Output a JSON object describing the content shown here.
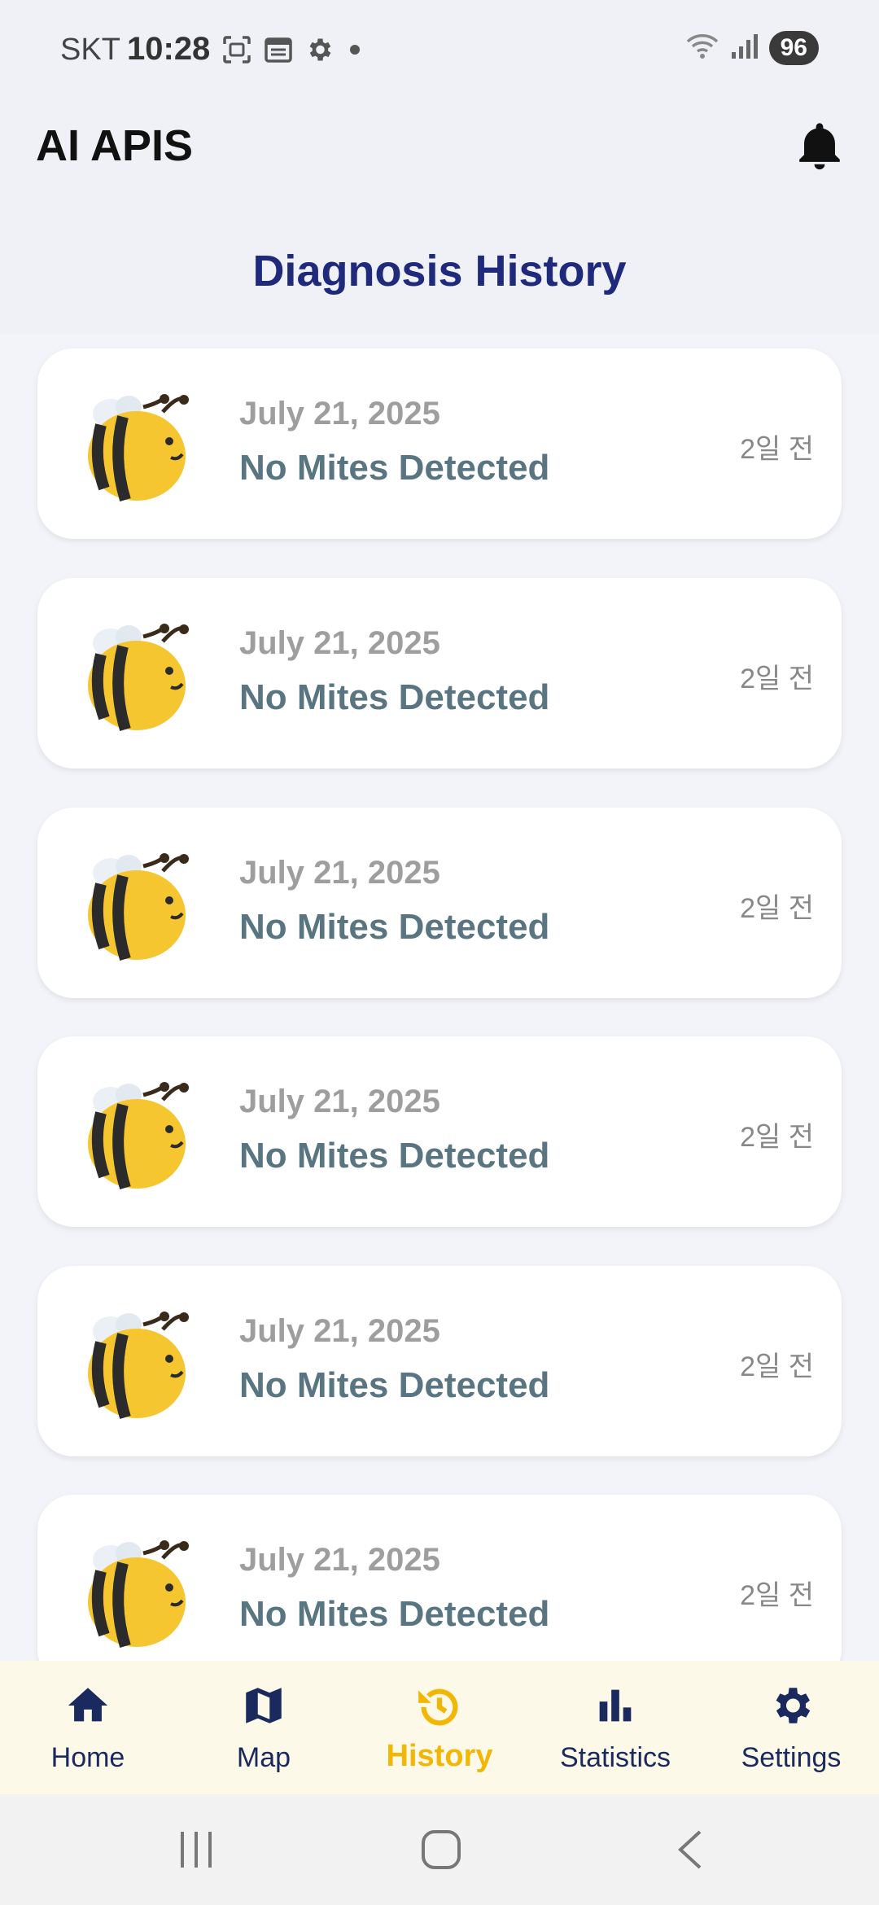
{
  "status_bar": {
    "carrier": "SKT",
    "time": "10:28",
    "battery": "96",
    "icons": [
      "screenshot-icon",
      "calendar-icon",
      "gear-icon",
      "dot-icon",
      "wifi-icon",
      "signal-icon"
    ]
  },
  "app_bar": {
    "title": "AI APIS",
    "notification_icon": "bell-icon"
  },
  "page": {
    "title": "Diagnosis History"
  },
  "history_items": [
    {
      "date": "July 21, 2025",
      "result": "No Mites Detected",
      "ago": "2일 전",
      "icon": "bee-icon"
    },
    {
      "date": "July 21, 2025",
      "result": "No Mites Detected",
      "ago": "2일 전",
      "icon": "bee-icon"
    },
    {
      "date": "July 21, 2025",
      "result": "No Mites Detected",
      "ago": "2일 전",
      "icon": "bee-icon"
    },
    {
      "date": "July 21, 2025",
      "result": "No Mites Detected",
      "ago": "2일 전",
      "icon": "bee-icon"
    },
    {
      "date": "July 21, 2025",
      "result": "No Mites Detected",
      "ago": "2일 전",
      "icon": "bee-icon"
    },
    {
      "date": "July 21, 2025",
      "result": "No Mites Detected",
      "ago": "2일 전",
      "icon": "bee-icon"
    }
  ],
  "bottom_nav": {
    "items": [
      {
        "label": "Home",
        "icon": "home-icon"
      },
      {
        "label": "Map",
        "icon": "map-icon"
      },
      {
        "label": "History",
        "icon": "history-icon",
        "active": true
      },
      {
        "label": "Statistics",
        "icon": "bar-chart-icon"
      },
      {
        "label": "Settings",
        "icon": "gear-icon"
      }
    ]
  },
  "colors": {
    "title_blue": "#1f2a7c",
    "nav_active": "#f2b705",
    "nav_inactive": "#1a2a5e",
    "result_text": "#5a7582",
    "nav_background": "#fdf9e9"
  }
}
